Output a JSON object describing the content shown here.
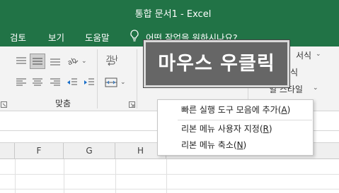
{
  "window": {
    "title": "통합 문서1  -  Excel"
  },
  "tabs": [
    {
      "label": "검토"
    },
    {
      "label": "보기"
    },
    {
      "label": "도움말"
    }
  ],
  "tell_me": {
    "text": "어떤 작업을 원하시나요?",
    "icon": "lightbulb-icon"
  },
  "ribbon": {
    "group_label": "맞춤",
    "wrap_icon_label": "가나",
    "styles_right": {
      "item1": "서식",
      "item2": "식",
      "item3": "일 스타일"
    },
    "icons": [
      "align-top-icon",
      "align-middle-icon",
      "align-bottom-icon",
      "orientation-icon",
      "wrap-text-icon",
      "align-left-icon",
      "align-center-icon",
      "align-right-icon",
      "decrease-indent-icon",
      "increase-indent-icon",
      "merge-center-icon",
      "dialog-launcher-icon"
    ]
  },
  "overlay": {
    "text": "마우스 우클릭"
  },
  "context_menu": {
    "items": [
      {
        "label": "빠른 실행 도구 모음에 추가",
        "accel": "A"
      },
      {
        "label": "리본 메뉴 사용자 지정",
        "accel": "R"
      },
      {
        "label": "리본 메뉴 축소",
        "accel": "N"
      }
    ]
  },
  "columns": [
    "F",
    "G",
    "H"
  ],
  "colors": {
    "excel_green": "#217346",
    "ribbon_bg": "#f3f3f3",
    "overlay_bg": "#666666"
  }
}
